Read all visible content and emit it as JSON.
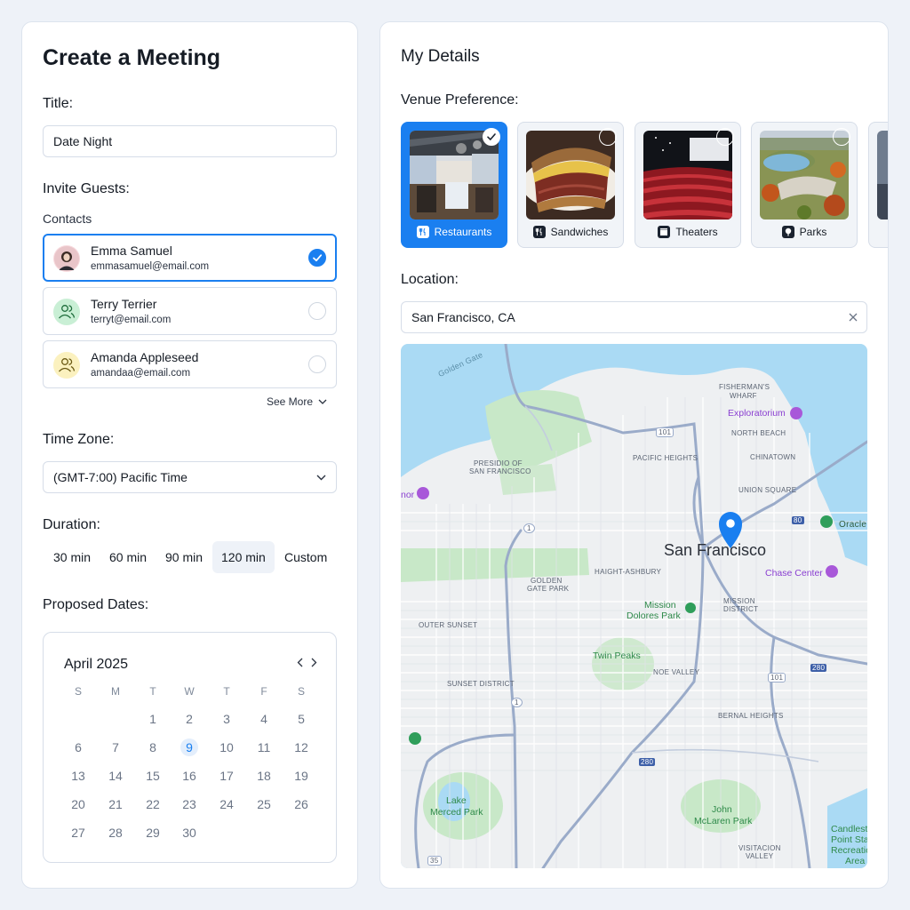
{
  "meeting": {
    "heading": "Create a Meeting",
    "title_label": "Title:",
    "title_value": "Date Night",
    "guests_label": "Invite Guests:",
    "contacts_label": "Contacts",
    "contacts": [
      {
        "name": "Emma Samuel",
        "email": "emmasamuel@email.com",
        "selected": true
      },
      {
        "name": "Terry Terrier",
        "email": "terryt@email.com",
        "selected": false
      },
      {
        "name": "Amanda Appleseed",
        "email": "amandaa@email.com",
        "selected": false
      }
    ],
    "see_more": "See More",
    "timezone_label": "Time Zone:",
    "timezone_value": "(GMT-7:00) Pacific Time",
    "duration_label": "Duration:",
    "durations": [
      "30 min",
      "60 min",
      "90 min",
      "120 min",
      "Custom"
    ],
    "duration_selected": "120 min",
    "dates_label": "Proposed Dates:",
    "calendar": {
      "month": "April 2025",
      "weekdays": [
        "S",
        "M",
        "T",
        "W",
        "T",
        "F",
        "S"
      ],
      "first_weekday_index": 2,
      "days_in_month": 30,
      "today": 9,
      "prev_icon": "chevron-left-icon",
      "next_icon": "chevron-right-icon"
    }
  },
  "details": {
    "heading": "My Details",
    "venue_label": "Venue Preference:",
    "venues": [
      {
        "label": "Restaurants",
        "icon": "fork-knife-icon",
        "selected": true
      },
      {
        "label": "Sandwiches",
        "icon": "fork-knife-icon",
        "selected": false
      },
      {
        "label": "Theaters",
        "icon": "clapperboard-icon",
        "selected": false
      },
      {
        "label": "Parks",
        "icon": "tree-icon",
        "selected": false
      }
    ],
    "location_label": "Location:",
    "location_value": "San Francisco, CA",
    "map": {
      "city": "San Francisco",
      "labels": {
        "golden_gate": "Golden Gate",
        "fishermans": "FISHERMAN'S",
        "wharf": "WHARF",
        "exploratorium": "Exploratorium",
        "north_beach": "NORTH BEACH",
        "pacific_heights": "PACIFIC HEIGHTS",
        "chinatown": "CHINATOWN",
        "presidio1": "PRESIDIO OF",
        "presidio2": "SAN FRANCISCO",
        "union_square": "UNION SQUARE",
        "oracle": "Oracle",
        "haight": "HAIGHT-ASHBURY",
        "chase": "Chase Center",
        "ggpark1": "GOLDEN",
        "ggpark2": "GATE PARK",
        "mission1": "MISSION",
        "mission2": "DISTRICT",
        "dolores1": "Mission",
        "dolores2": "Dolores Park",
        "outer_sunset": "OUTER SUNSET",
        "twin_peaks": "Twin Peaks",
        "noe": "NOE VALLEY",
        "sunset": "SUNSET DISTRICT",
        "bernal": "BERNAL HEIGHTS",
        "lake1": "Lake",
        "lake2": "Merced Park",
        "mclaren1": "John",
        "mclaren2": "McLaren Park",
        "visitacion1": "VISITACION",
        "visitacion2": "VALLEY",
        "candlestick1": "Candlest",
        "candlestick2": "Point Sta",
        "candlestick3": "Recreatio",
        "candlestick4": "Area",
        "honor": "nor",
        "hw101a": "101",
        "hw101b": "101",
        "hw1a": "1",
        "hw1b": "1",
        "hw80": "80",
        "hw280a": "280",
        "hw280b": "280",
        "hw35": "35"
      }
    }
  },
  "colors": {
    "accent": "#1a7ff0",
    "water": "#aadaf4",
    "park": "#c8e8c8"
  }
}
